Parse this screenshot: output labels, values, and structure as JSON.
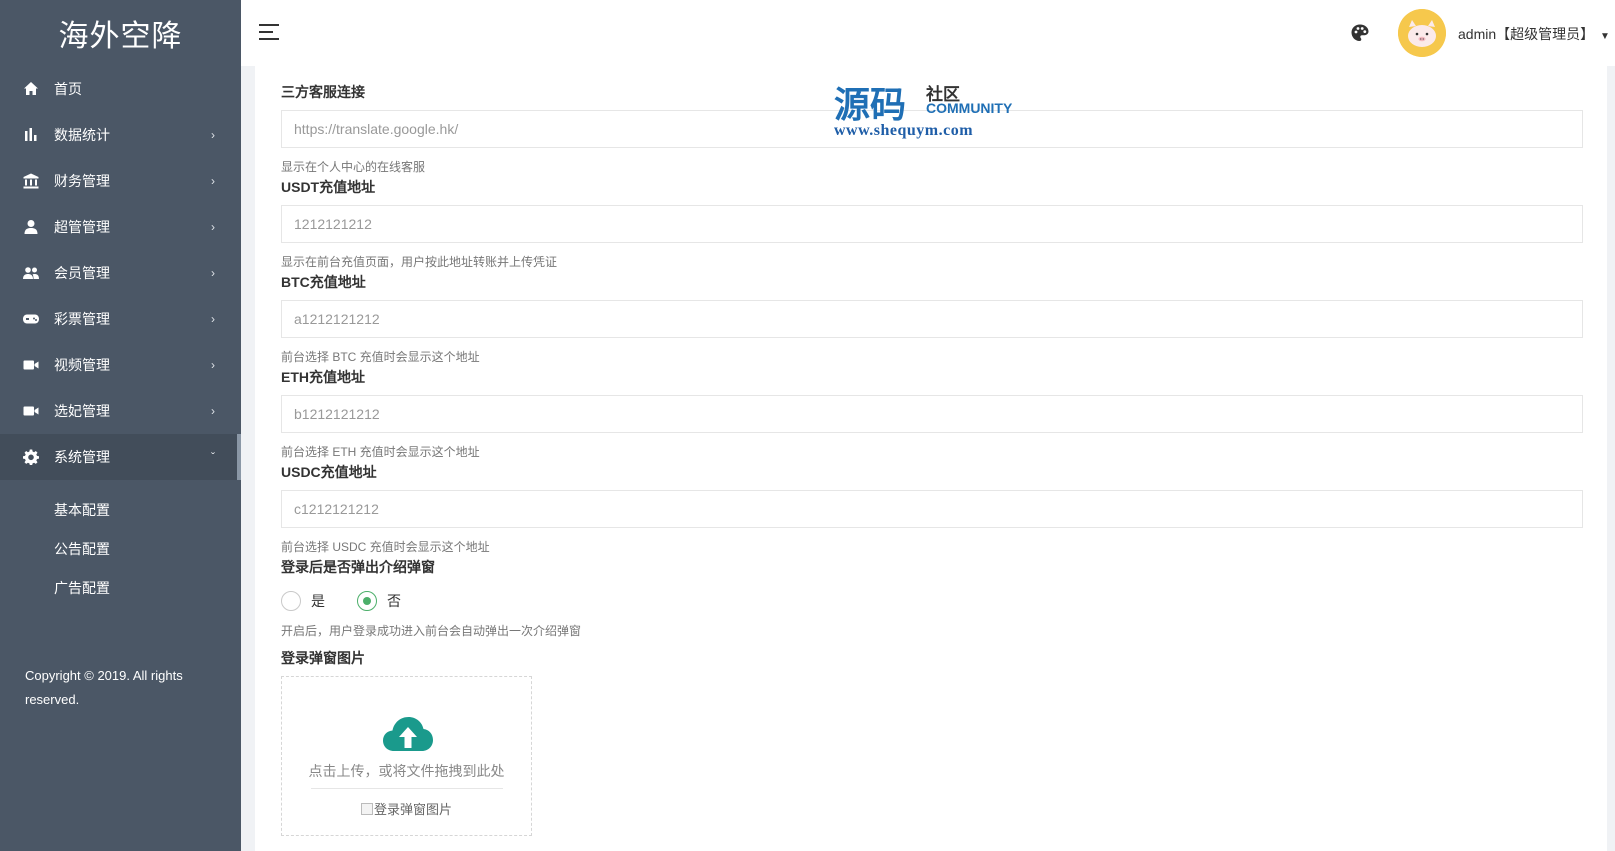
{
  "sidebar": {
    "logo": "海外空降",
    "items": [
      {
        "label": "首页",
        "icon": "home-icon"
      },
      {
        "label": "数据统计",
        "icon": "bar-chart-icon"
      },
      {
        "label": "财务管理",
        "icon": "bank-icon"
      },
      {
        "label": "超管管理",
        "icon": "user-icon"
      },
      {
        "label": "会员管理",
        "icon": "users-icon"
      },
      {
        "label": "彩票管理",
        "icon": "gamepad-icon"
      },
      {
        "label": "视频管理",
        "icon": "video-icon"
      },
      {
        "label": "选妃管理",
        "icon": "video-icon"
      },
      {
        "label": "系统管理",
        "icon": "gear-icon"
      }
    ],
    "submenu": [
      "基本配置",
      "公告配置",
      "广告配置"
    ],
    "copyright": "Copyright © 2019. All rights reserved."
  },
  "header": {
    "user": "admin【超级管理员】",
    "accent": "#f6c84c"
  },
  "form": {
    "service": {
      "label": "三方客服连接",
      "value": "https://translate.google.hk/",
      "help": "显示在个人中心的在线客服"
    },
    "usdt": {
      "label": "USDT充值地址",
      "value": "1212121212",
      "help": "显示在前台充值页面，用户按此地址转账并上传凭证"
    },
    "btc": {
      "label": "BTC充值地址",
      "value": "a1212121212",
      "help": "前台选择 BTC 充值时会显示这个地址"
    },
    "eth": {
      "label": "ETH充值地址",
      "value": "b1212121212",
      "help": "前台选择 ETH 充值时会显示这个地址"
    },
    "usdc": {
      "label": "USDC充值地址",
      "value": "c1212121212",
      "help": "前台选择 USDC 充值时会显示这个地址"
    },
    "popup": {
      "label": "登录后是否弹出介绍弹窗",
      "yes": "是",
      "no": "否",
      "selected": "否",
      "help": "开启后，用户登录成功进入前台会自动弹出一次介绍弹窗"
    },
    "popup_image": {
      "label": "登录弹窗图片",
      "hint": "点击上传，或将文件拖拽到此处",
      "preview_alt": "登录弹窗图片"
    }
  },
  "watermark": {
    "big": "源码",
    "small": "社区",
    "en": "COMMUNITY",
    "url": "www.shequym.com"
  },
  "colors": {
    "sidebar": "#4b5766",
    "radio_checked": "#4caf6a",
    "upload_icon": "#1a9a8c"
  }
}
